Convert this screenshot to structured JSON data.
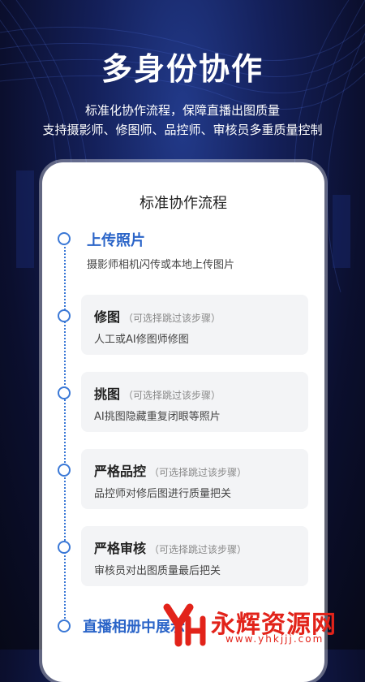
{
  "hero": {
    "title": "多身份协作",
    "subtitle_line1": "标准化协作流程，保障直播出图质量",
    "subtitle_line2": "支持摄影师、修图师、品控师、审核员多重质量控制"
  },
  "card": {
    "title": "标准协作流程",
    "steps": [
      {
        "title": "上传照片",
        "optional": "",
        "desc": "摄影师相机闪传或本地上传图片"
      },
      {
        "title": "修图",
        "optional": "（可选择跳过该步骤）",
        "desc": "人工或AI修图师修图"
      },
      {
        "title": "挑图",
        "optional": "（可选择跳过该步骤）",
        "desc": "AI挑图隐藏重复闭眼等照片"
      },
      {
        "title": "严格品控",
        "optional": "（可选择跳过该步骤）",
        "desc": "品控师对修后图进行质量把关"
      },
      {
        "title": "严格审核",
        "optional": "（可选择跳过该步骤）",
        "desc": "审核员对出图质量最后把关"
      },
      {
        "title": "直播相册中展示",
        "optional": "",
        "desc": ""
      }
    ]
  },
  "watermark": {
    "name": "永辉资源网",
    "url": "www.yhkjjj.com"
  },
  "colors": {
    "accent_blue": "#2a64c8",
    "watermark_red": "#e2231a",
    "background_dark": "#0b0f2e"
  }
}
